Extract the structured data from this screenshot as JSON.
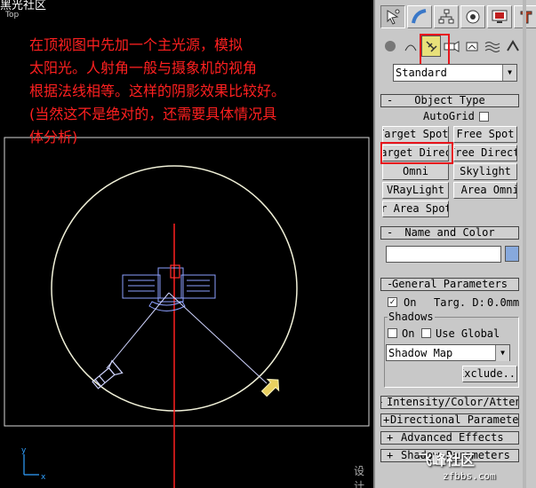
{
  "watermarks": {
    "top_left": "黑光社区",
    "bottom_italic": "设计",
    "logo": "飞峰社区",
    "url": "zfbbs.com"
  },
  "viewport": {
    "label": "Top",
    "note_lines": [
      "在顶视图中先加一个主光源，模拟",
      "太阳光。人射角一般与摄象机的视角",
      "根据法线相等。这样的阴影效果比较好。",
      "(当然这不是绝对的，还需要具体情况具",
      "体分析)"
    ],
    "note_color": "#ff2020"
  },
  "command_panel": {
    "tabs": [
      "create-icon",
      "modify-icon",
      "hierarchy-icon",
      "motion-icon",
      "display-icon",
      "utilities-icon"
    ],
    "category_icons": [
      "geometry-icon",
      "shapes-icon",
      "lights-icon",
      "cameras-icon",
      "helpers-icon",
      "space-warps-icon",
      "systems-icon"
    ],
    "active_category": "lights-icon",
    "highlight_color": "#e8141c",
    "type_dropdown": {
      "value": "Standard"
    },
    "object_type": {
      "title": "Object Type",
      "autogrid_label": "AutoGrid",
      "buttons": [
        "Target Spot",
        "Free Spot",
        "Target Direct",
        "Free Direct",
        "Omni",
        "Skylight",
        "VRayLight",
        "mr Area Omni",
        "mr Area Spot"
      ]
    },
    "name_color": {
      "title": "Name and Color",
      "name_value": "",
      "swatch_color": "#87a9dd"
    },
    "general_parameters": {
      "title": "General Parameters",
      "on_label": "On",
      "on_checked": true,
      "targ_label": "Targ. D:",
      "targ_value": "0.0mm",
      "shadows_label": "Shadows",
      "shadows_on_label": "On",
      "use_global_label": "Use Global",
      "shadow_type": "Shadow Map",
      "exclude_label": "Exclude..."
    },
    "collapsed_rollouts": [
      {
        "sign": "+",
        "label": "Intensity/Color/Attenuation"
      },
      {
        "sign": "+",
        "label": "Directional Parameters"
      },
      {
        "sign": "+",
        "label": "Advanced Effects"
      },
      {
        "sign": "+",
        "label": "Shadow Parameters"
      }
    ]
  }
}
